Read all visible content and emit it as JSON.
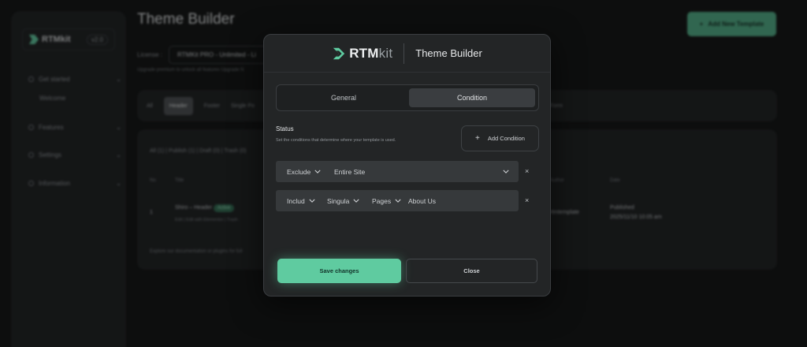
{
  "background": {
    "page_title": "Theme Builder",
    "add_button": "Add New Template",
    "license_label": "License :",
    "license_value": "RTMKit PRO - Unlimited - Li",
    "upgrade_text": "Upgrade premium to unlock all features Upgrade N",
    "sidebar": {
      "brand": "RTMkit",
      "version": "v2.0",
      "items": [
        {
          "label": "Get started"
        },
        {
          "label": "Welcome"
        },
        {
          "label": "Features"
        },
        {
          "label": "Settings"
        },
        {
          "label": "Information"
        }
      ]
    },
    "tabs": [
      "All",
      "Header",
      "Footer",
      "Single Po",
      "Form"
    ],
    "filters": "All (1) | Publish (1) | Draft (0) | Trash (0)",
    "table_headers": [
      "No",
      "Title",
      "Author",
      "Date"
    ],
    "row": {
      "no": "1",
      "title": "Shiro – Header",
      "badge": "Active",
      "actions": "Edit | Edit with Elementor | Trash",
      "author": "rtmtemplate",
      "date_status": "Published",
      "date_value": "2025/11/10 10:05 am"
    },
    "footer": "Explore our documentation or plugins for full"
  },
  "modal": {
    "brand_main": "RTM",
    "brand_kit": "kit",
    "title": "Theme Builder",
    "tabs": {
      "general": "General",
      "condition": "Condition"
    },
    "status_label": "Status",
    "status_desc": "Set the conditions that determine where your template is used.",
    "add_condition": "Add Condition",
    "conditions": [
      {
        "type": "Exclude",
        "target": "Entire Site"
      },
      {
        "type": "Includ",
        "scope": "Singula",
        "object": "Pages",
        "value": "About Us"
      }
    ],
    "remove_icon": "×",
    "save": "Save changes",
    "close": "Close"
  },
  "colors": {
    "accent": "#5fcba0",
    "panel": "#232526",
    "field": "#36393b"
  }
}
